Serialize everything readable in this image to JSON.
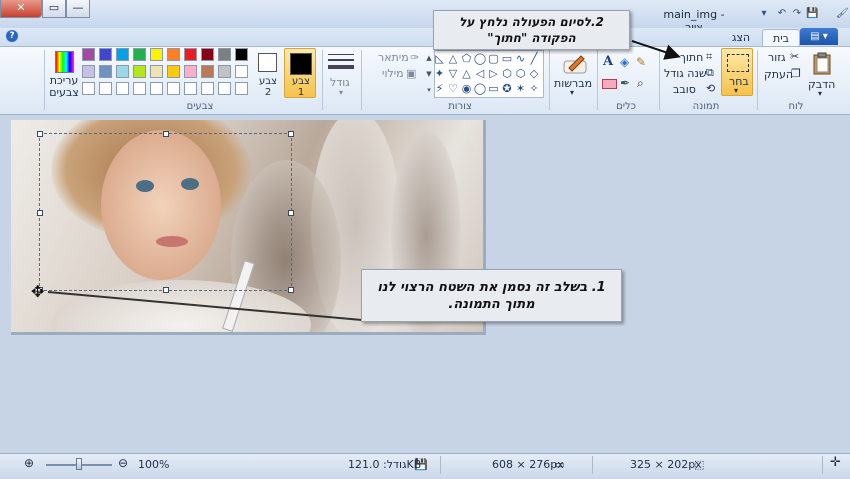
{
  "window": {
    "title": "main_img - צייר",
    "close_label": "✕",
    "max_label": "▭",
    "min_label": "—"
  },
  "tabs": {
    "file_label": "▤ ▾",
    "home": "בית",
    "view": "הצג"
  },
  "ribbon": {
    "clipboard": {
      "group": "לוח",
      "paste": "הדבק",
      "cut": "גזור",
      "copy": "העתק"
    },
    "image": {
      "group": "תמונה",
      "select": "בחר",
      "crop": "חתוך",
      "resize": "שנה גודל",
      "rotate": "סובב"
    },
    "tools": {
      "group": "כלים"
    },
    "brushes": {
      "label": "מברשות"
    },
    "shapes": {
      "group": "צורות",
      "outline": "מיתאר",
      "fill": "מילוי"
    },
    "size": {
      "label": "גודל"
    },
    "colors": {
      "group": "צבעים",
      "color1": "צבע 1",
      "color2": "צבע 2",
      "edit": "עריכת צבעים",
      "palette_row1": [
        "#000000",
        "#7f7f7f",
        "#880015",
        "#ed1c24",
        "#ff7f27",
        "#fff200",
        "#22b14c",
        "#00a2e8",
        "#3f48cc",
        "#a349a4"
      ],
      "palette_row2": [
        "#ffffff",
        "#c3c3c3",
        "#b97a57",
        "#ffaec9",
        "#ffc90e",
        "#efe4b0",
        "#b5e61d",
        "#99d9ea",
        "#7092be",
        "#c8bfe7"
      ],
      "color1_value": "#000000",
      "color2_value": "#ffffff"
    }
  },
  "callouts": {
    "step2_line1": "2.לסיום הפעולה נלחץ על",
    "step2_line2": "הפקודה \"חתוך\"",
    "step1_line1": "1. בשלב זה נסמן את השטח הרצוי לנו",
    "step1_line2": "מתוך התמונה."
  },
  "status": {
    "selection_size": "325 × 202px",
    "image_size": "608 × 276px",
    "file_size": "גודל: 121.0KB",
    "zoom": "100%",
    "zoom_fraction": 0.5
  }
}
